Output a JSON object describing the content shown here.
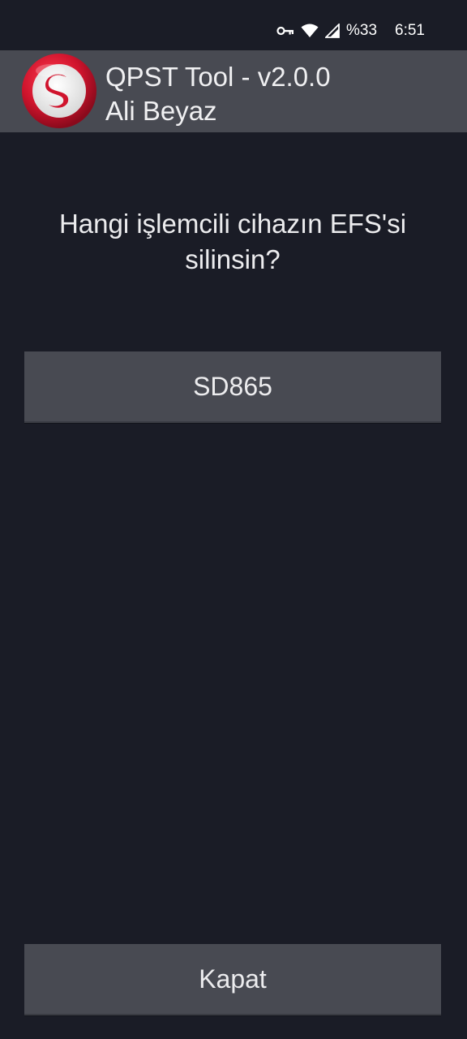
{
  "status_bar": {
    "battery": "%33",
    "time": "6:51",
    "icons": [
      "vpn-key-icon",
      "wifi-icon",
      "signal-icon"
    ]
  },
  "title_bar": {
    "title": "QPST Tool - v2.0.0",
    "subtitle": "Ali Beyaz",
    "icon": "qualcomm-snapdragon-logo"
  },
  "main": {
    "question": "Hangi işlemcili cihazın EFS'si silinsin?",
    "options": [
      "SD865"
    ],
    "close_label": "Kapat"
  },
  "colors": {
    "background": "#1a1c26",
    "panel": "#484a52",
    "logo_red": "#c8102e"
  }
}
